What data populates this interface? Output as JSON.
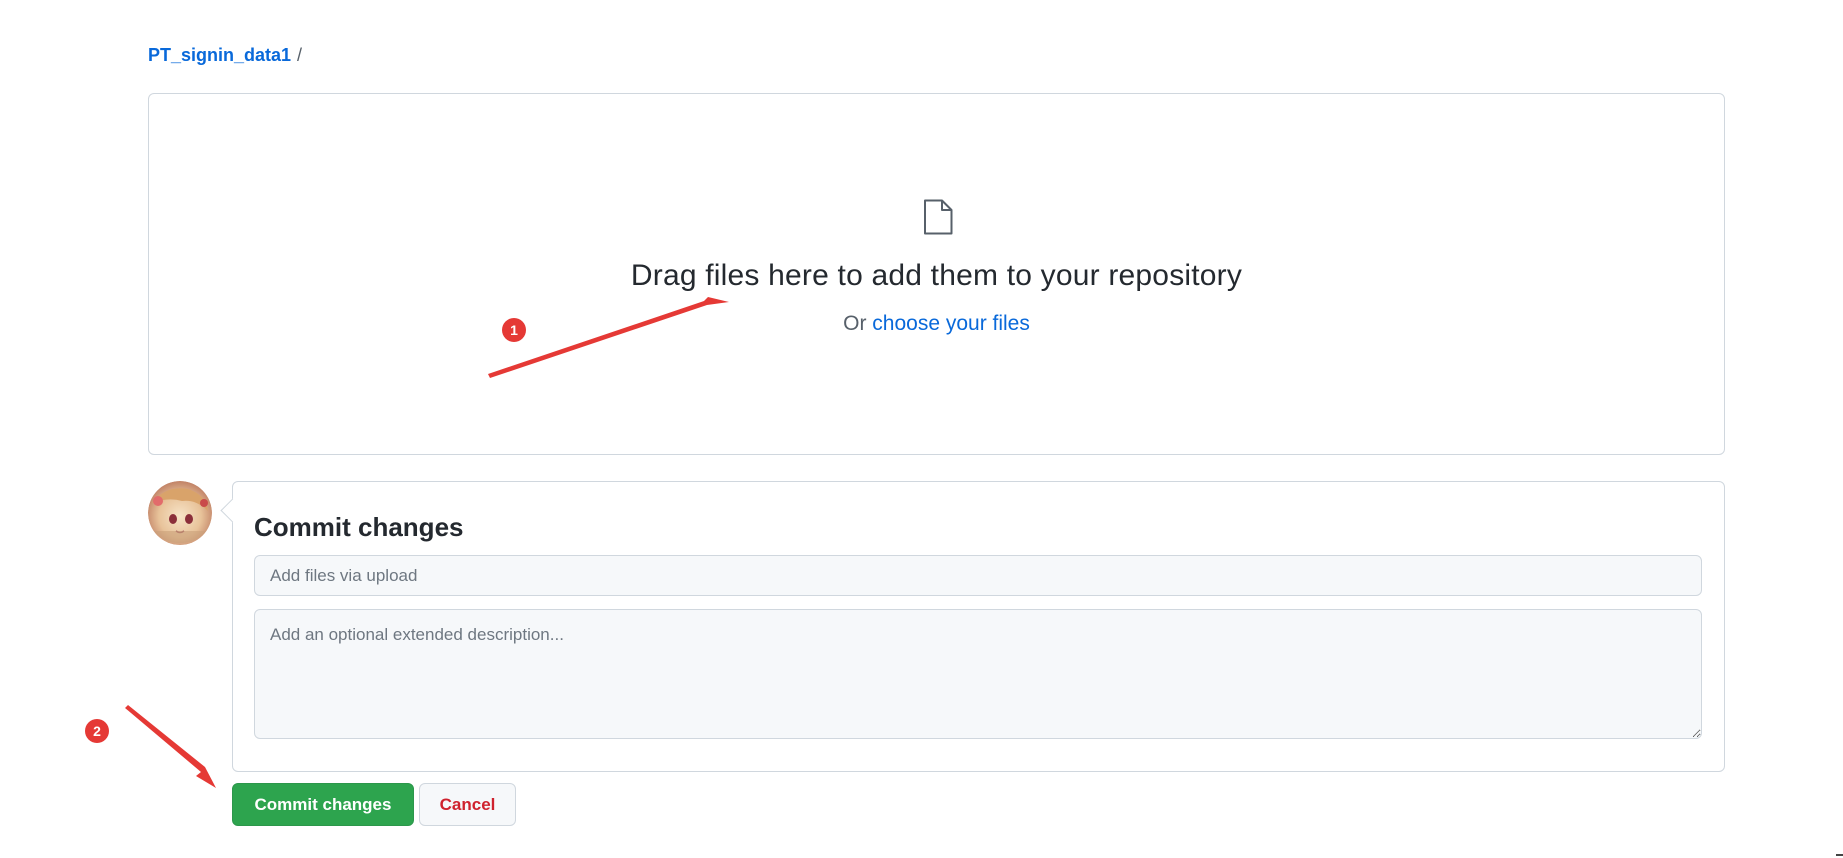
{
  "breadcrumb": {
    "repo": "PT_signin_data1",
    "separator": "/"
  },
  "dropzone": {
    "icon": "file-icon",
    "headline": "Drag files here to add them to your repository",
    "sub_prefix": "Or",
    "choose_link": "choose your files"
  },
  "commit": {
    "title": "Commit changes",
    "summary_placeholder": "Add files via upload",
    "description_placeholder": "Add an optional extended description...",
    "commit_button": "Commit changes",
    "cancel_button": "Cancel"
  },
  "annotations": {
    "badge_1": "1",
    "badge_2": "2",
    "color": "#e53935"
  },
  "colors": {
    "link": "#0969da",
    "primary_button": "#2da44e",
    "danger_text": "#cf222e",
    "border": "#d0d7de"
  }
}
